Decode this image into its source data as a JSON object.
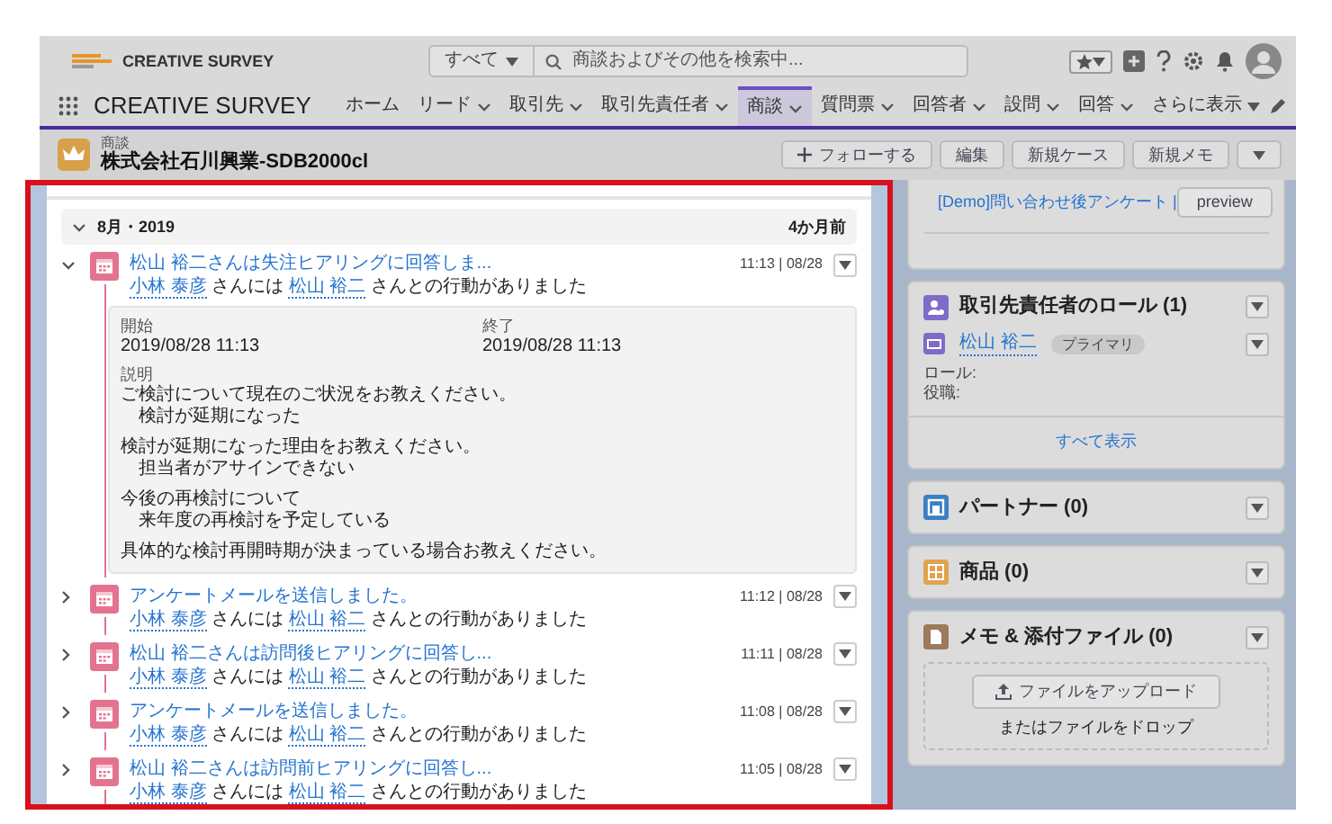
{
  "header": {
    "logo": "CREATIVE SURVEY",
    "search_scope": "すべて",
    "search_placeholder": "商談およびその他を検索中..."
  },
  "nav": {
    "app_name": "CREATIVE SURVEY",
    "more": "さらに表示",
    "tabs": [
      {
        "label": "ホーム",
        "has_menu": false,
        "selected": false
      },
      {
        "label": "リード",
        "has_menu": true,
        "selected": false
      },
      {
        "label": "取引先",
        "has_menu": true,
        "selected": false
      },
      {
        "label": "取引先責任者",
        "has_menu": true,
        "selected": false
      },
      {
        "label": "商談",
        "has_menu": true,
        "selected": true
      },
      {
        "label": "質問票",
        "has_menu": true,
        "selected": false
      },
      {
        "label": "回答者",
        "has_menu": true,
        "selected": false
      },
      {
        "label": "設問",
        "has_menu": true,
        "selected": false
      },
      {
        "label": "回答",
        "has_menu": true,
        "selected": false
      }
    ]
  },
  "record": {
    "object_type": "商談",
    "name": "株式会社石川興業-SDB2000cl",
    "actions": [
      {
        "label": "フォローする",
        "kind": "follow"
      },
      {
        "label": "編集",
        "kind": "plain"
      },
      {
        "label": "新規ケース",
        "kind": "plain"
      },
      {
        "label": "新規メモ",
        "kind": "plain"
      }
    ]
  },
  "timeline": {
    "month": "8月・2019",
    "ago": "4か月前",
    "items": [
      {
        "title": "松山 裕二さんは失注ヒアリングに回答しま...",
        "time": "11:13 | 08/28",
        "expanded": true,
        "assignee": "小林 泰彦",
        "mid": "さんには",
        "contact": "松山 裕二",
        "tail": "さんとの行動がありました",
        "details": {
          "start_label": "開始",
          "start": "2019/08/28 11:13",
          "end_label": "終了",
          "end": "2019/08/28 11:13",
          "description_label": "説明",
          "description": [
            {
              "question": "ご検討について現在のご状況をお教えください。",
              "answer": "検討が延期になった"
            },
            {
              "question": "検討が延期になった理由をお教えください。",
              "answer": "担当者がアサインできない"
            },
            {
              "question": "今後の再検討について",
              "answer": "来年度の再検討を予定している"
            },
            {
              "question": "具体的な検討再開時期が決まっている場合お教えください。"
            }
          ]
        }
      },
      {
        "title": "アンケートメールを送信しました。",
        "time": "11:12 | 08/28",
        "expanded": false,
        "assignee": "小林 泰彦",
        "mid": "さんには",
        "contact": "松山 裕二",
        "tail": "さんとの行動がありました"
      },
      {
        "title": "松山 裕二さんは訪問後ヒアリングに回答し...",
        "time": "11:11 | 08/28",
        "expanded": false,
        "assignee": "小林 泰彦",
        "mid": "さんには",
        "contact": "松山 裕二",
        "tail": "さんとの行動がありました"
      },
      {
        "title": "アンケートメールを送信しました。",
        "time": "11:08 | 08/28",
        "expanded": false,
        "assignee": "小林 泰彦",
        "mid": "さんには",
        "contact": "松山 裕二",
        "tail": "さんとの行動がありました"
      },
      {
        "title": "松山 裕二さんは訪問前ヒアリングに回答し...",
        "time": "11:05 | 08/28",
        "expanded": false,
        "assignee": "小林 泰彦",
        "mid": "さんには",
        "contact": "松山 裕二",
        "tail": "さんとの行動がありました"
      }
    ]
  },
  "sidebar": {
    "survey_link": "[Demo]問い合わせ後アンケート |",
    "preview_button": "preview",
    "cards": [
      {
        "kind": "roles",
        "title": "取引先責任者のロール (1)",
        "contact": "松山 裕二",
        "badge": "プライマリ",
        "fields": [
          "ロール:",
          "役職:"
        ],
        "footer_link": "すべて表示"
      },
      {
        "kind": "partners",
        "title": "パートナー (0)"
      },
      {
        "kind": "products",
        "title": "商品 (0)"
      },
      {
        "kind": "notes",
        "title": "メモ & 添付ファイル (0)",
        "upload_button": "ファイルをアップロード",
        "drop_hint": "またはファイルをドロップ"
      }
    ]
  }
}
